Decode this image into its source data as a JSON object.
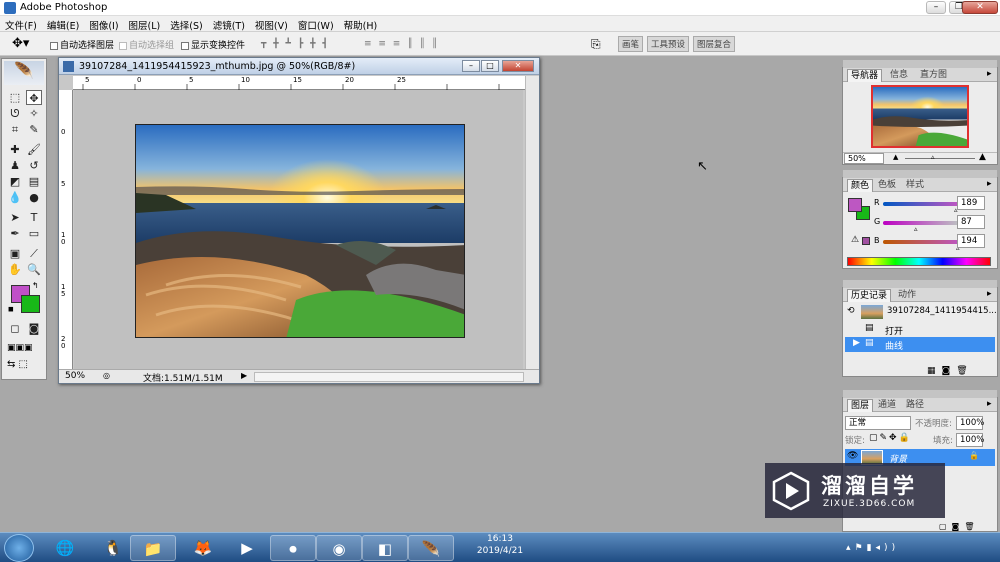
{
  "app": {
    "title": "Adobe Photoshop"
  },
  "menu": [
    "文件(F)",
    "编辑(E)",
    "图像(I)",
    "图层(L)",
    "选择(S)",
    "滤镜(T)",
    "视图(V)",
    "窗口(W)",
    "帮助(H)"
  ],
  "options": {
    "auto_select_layer": "自动选择图层",
    "auto_select_group": "自动选择组",
    "show_transform": "显示变换控件",
    "well_tabs": [
      "画笔",
      "工具预设",
      "图层复合"
    ]
  },
  "document": {
    "title": "39107284_1411954415923_mthumb.jpg @ 50%(RGB/8#)",
    "zoom": "50%",
    "doc_size": "文档:1.51M/1.51M",
    "ruler_h": [
      "5",
      "0",
      "5",
      "10",
      "15",
      "20",
      "25"
    ],
    "ruler_v": [
      "0",
      "5",
      "1 0",
      "1 5",
      "2 0"
    ]
  },
  "navigator": {
    "tabs": [
      "导航器",
      "信息",
      "直方图"
    ],
    "zoom": "50%"
  },
  "color_panel": {
    "tabs": [
      "颜色",
      "色板",
      "样式"
    ],
    "r_label": "R",
    "g_label": "G",
    "b_label": "B",
    "r": "189",
    "g": "87",
    "b": "194",
    "r_level": 0.74,
    "g_level": 0.34,
    "b_level": 0.76,
    "fg_color": "#bd57c2",
    "bg_color": "#18b818"
  },
  "history": {
    "tabs": [
      "历史记录",
      "动作"
    ],
    "snapshot": "39107284_1411954415...",
    "items": [
      "打开",
      "曲线"
    ]
  },
  "layers": {
    "tabs": [
      "图层",
      "通道",
      "路径"
    ],
    "blend_mode": "正常",
    "opacity_label": "不透明度:",
    "opacity": "100%",
    "lock_label": "锁定:",
    "fill_label": "填充:",
    "fill": "100%",
    "layer_name": "背景"
  },
  "watermark": {
    "name": "溜溜自学",
    "url": "ZIXUE.3D66.COM"
  },
  "taskbar": {
    "time": "16:13",
    "date": "2019/4/21"
  }
}
